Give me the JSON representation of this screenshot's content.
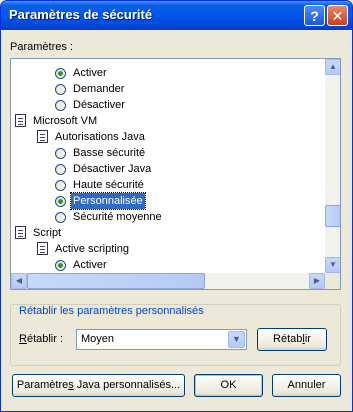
{
  "window": {
    "title": "Paramètres de sécurité",
    "help_btn": "?",
    "close_btn": "✕"
  },
  "settings_label": "Paramètres :",
  "tree": [
    {
      "type": "radio",
      "label": "Activer",
      "checked": true
    },
    {
      "type": "radio",
      "label": "Demander",
      "checked": false
    },
    {
      "type": "radio",
      "label": "Désactiver",
      "checked": false
    },
    {
      "type": "folder",
      "label": "Microsoft VM"
    },
    {
      "type": "folder",
      "label": "Autorisations Java"
    },
    {
      "type": "radio",
      "label": "Basse sécurité",
      "checked": false
    },
    {
      "type": "radio",
      "label": "Désactiver Java",
      "checked": false
    },
    {
      "type": "radio",
      "label": "Haute sécurité",
      "checked": false
    },
    {
      "type": "radio",
      "label": "Personnalisée",
      "checked": true,
      "selected": true
    },
    {
      "type": "radio",
      "label": "Sécurité moyenne",
      "checked": false
    },
    {
      "type": "folder",
      "label": "Script"
    },
    {
      "type": "folder",
      "label": "Active scripting"
    },
    {
      "type": "radio",
      "label": "Activer",
      "checked": true
    }
  ],
  "reset_group": {
    "title": "Rétablir les paramètres personnalisés",
    "label": "Rétablir :",
    "value": "Moyen",
    "button": "Rétablir"
  },
  "buttons": {
    "java_custom": "Paramètres Java personnalisés...",
    "ok": "OK",
    "cancel": "Annuler"
  },
  "colors": {
    "accent": "#316ac5",
    "title_bar": "#0058ee",
    "check": "#21a121"
  }
}
